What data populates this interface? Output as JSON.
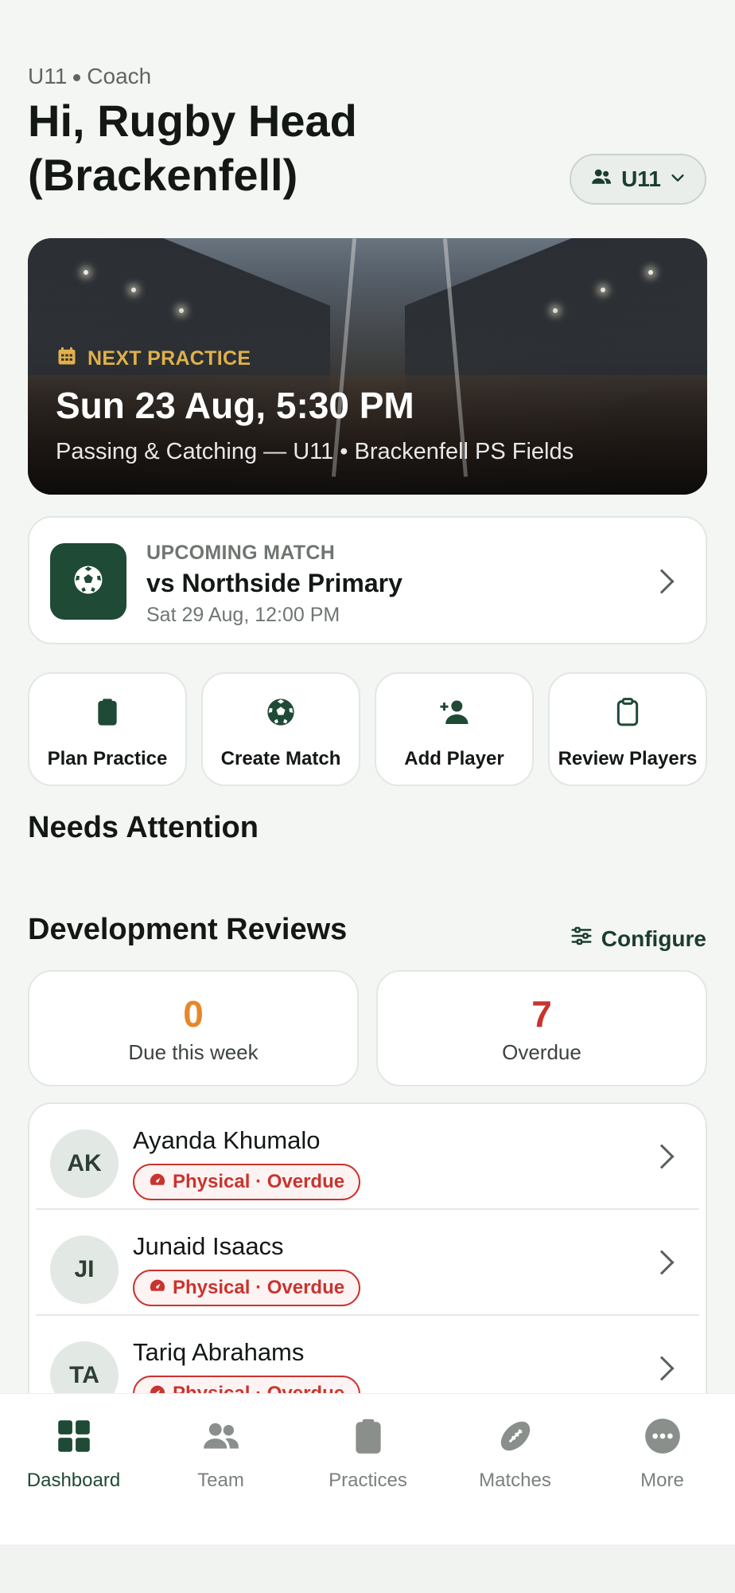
{
  "header": {
    "team": "U11",
    "role": "Coach",
    "greeting": "Hi, Rugby Head (Brackenfell)",
    "team_selector": "U11"
  },
  "next_practice": {
    "label": "NEXT PRACTICE",
    "datetime": "Sun 23 Aug, 5:30 PM",
    "details": "Passing & Catching — U11 • Brackenfell PS Fields"
  },
  "upcoming_match": {
    "label": "UPCOMING MATCH",
    "opponent": "vs Northside Primary",
    "when": "Sat 29 Aug, 12:00 PM"
  },
  "quick_actions": [
    {
      "label": "Plan Practice",
      "icon": "clipboard-icon"
    },
    {
      "label": "Create Match",
      "icon": "soccer-ball-icon"
    },
    {
      "label": "Add Player",
      "icon": "add-person-icon"
    },
    {
      "label": "Review Players",
      "icon": "clipboard-outline-icon"
    }
  ],
  "needs_attention": {
    "title": "Needs Attention"
  },
  "development_reviews": {
    "title": "Development Reviews",
    "configure_label": "Configure",
    "due": {
      "value": "0",
      "label": "Due this week",
      "color": "#e8862a"
    },
    "overdue": {
      "value": "7",
      "label": "Overdue",
      "color": "#c9342f"
    },
    "players": [
      {
        "initials": "AK",
        "name": "Ayanda Khumalo",
        "status": "Physical · Overdue"
      },
      {
        "initials": "JI",
        "name": "Junaid Isaacs",
        "status": "Physical · Overdue"
      },
      {
        "initials": "TA",
        "name": "Tariq Abrahams",
        "status": "Physical · Overdue"
      }
    ]
  },
  "nav": [
    {
      "label": "Dashboard",
      "icon": "dashboard-grid-icon",
      "active": true
    },
    {
      "label": "Team",
      "icon": "team-icon",
      "active": false
    },
    {
      "label": "Practices",
      "icon": "clipboard-icon",
      "active": false
    },
    {
      "label": "Matches",
      "icon": "rugby-ball-icon",
      "active": false
    },
    {
      "label": "More",
      "icon": "more-dots-icon",
      "active": false
    }
  ],
  "colors": {
    "brand_green": "#1f4a35",
    "accent_gold": "#e0b14a",
    "alert_red": "#c9342f",
    "due_orange": "#e8862a"
  }
}
